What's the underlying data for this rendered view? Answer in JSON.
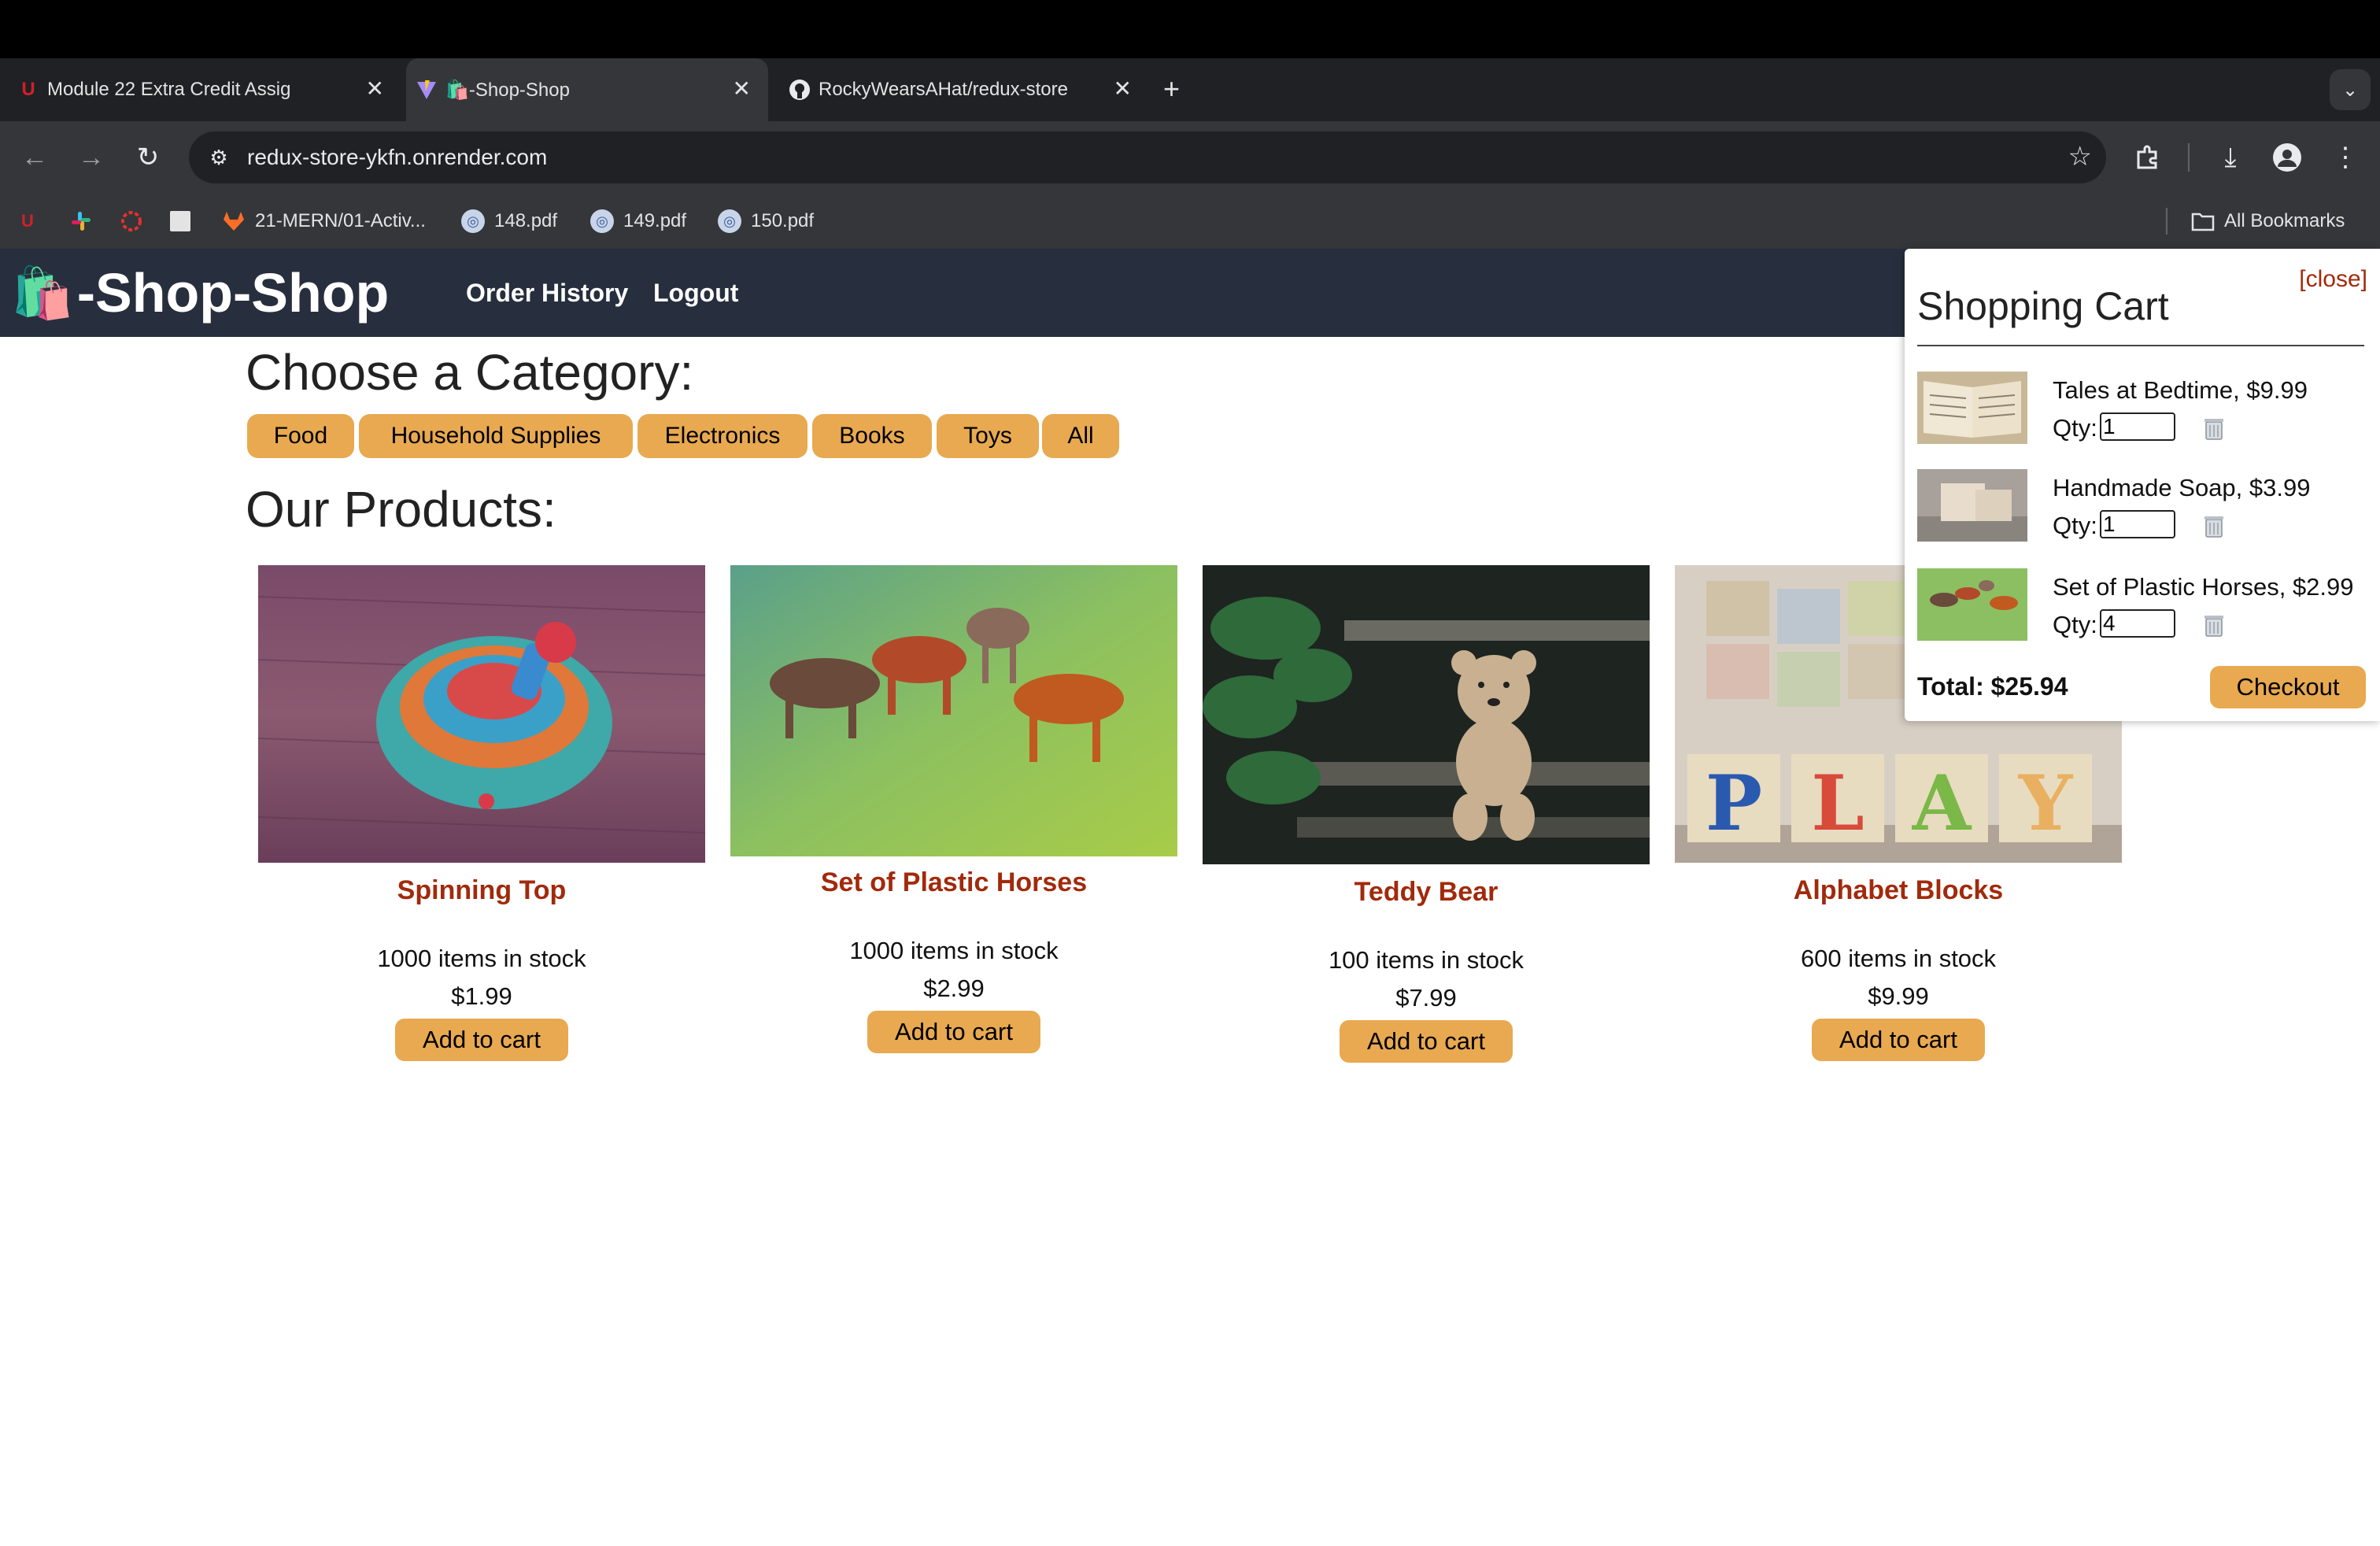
{
  "browser": {
    "tabs": [
      {
        "title": "Module 22 Extra Credit Assig",
        "icon": "u-logo-icon"
      },
      {
        "title": "🛍️-Shop-Shop",
        "icon": "vite-icon"
      },
      {
        "title": "RockyWearsAHat/redux-store",
        "icon": "github-icon"
      }
    ],
    "new_tab": "+",
    "url": "redux-store-ykfn.onrender.com",
    "bookmarks": [
      {
        "label": "",
        "icon": "u-logo-icon"
      },
      {
        "label": "",
        "icon": "slack-icon"
      },
      {
        "label": "",
        "icon": "canvas-icon"
      },
      {
        "label": "",
        "icon": "chart-icon"
      },
      {
        "label": "21-MERN/01-Activ...",
        "icon": "gitlab-icon"
      },
      {
        "label": "148.pdf",
        "icon": "globe-icon"
      },
      {
        "label": "149.pdf",
        "icon": "globe-icon"
      },
      {
        "label": "150.pdf",
        "icon": "globe-icon"
      }
    ],
    "all_bookmarks": "All Bookmarks"
  },
  "header": {
    "logo_emoji": "🛍️",
    "logo_text": "-Shop-Shop",
    "nav": [
      "Order History",
      "Logout"
    ]
  },
  "categories": {
    "heading": "Choose a Category:",
    "items": [
      "Food",
      "Household Supplies",
      "Electronics",
      "Books",
      "Toys",
      "All"
    ]
  },
  "products": {
    "heading": "Our Products:",
    "add_label": "Add to cart",
    "items": [
      {
        "name": "Spinning Top",
        "stock": "1000 items in stock",
        "price": "$1.99"
      },
      {
        "name": "Set of Plastic Horses",
        "stock": "1000 items in stock",
        "price": "$2.99"
      },
      {
        "name": "Teddy Bear",
        "stock": "100 items in stock",
        "price": "$7.99"
      },
      {
        "name": "Alphabet Blocks",
        "stock": "600 items in stock",
        "price": "$9.99"
      }
    ]
  },
  "cart": {
    "close": "[close]",
    "title": "Shopping Cart",
    "qty_label": "Qty:",
    "items": [
      {
        "name": "Tales at Bedtime, $9.99",
        "qty": "1"
      },
      {
        "name": "Handmade Soap, $3.99",
        "qty": "1"
      },
      {
        "name": "Set of Plastic Horses, $2.99",
        "qty": "4"
      }
    ],
    "total": "Total: $25.94",
    "checkout": "Checkout"
  },
  "colors": {
    "accent": "#e8a951",
    "header_bg": "#272e3d",
    "product_name": "#a12a0c"
  }
}
